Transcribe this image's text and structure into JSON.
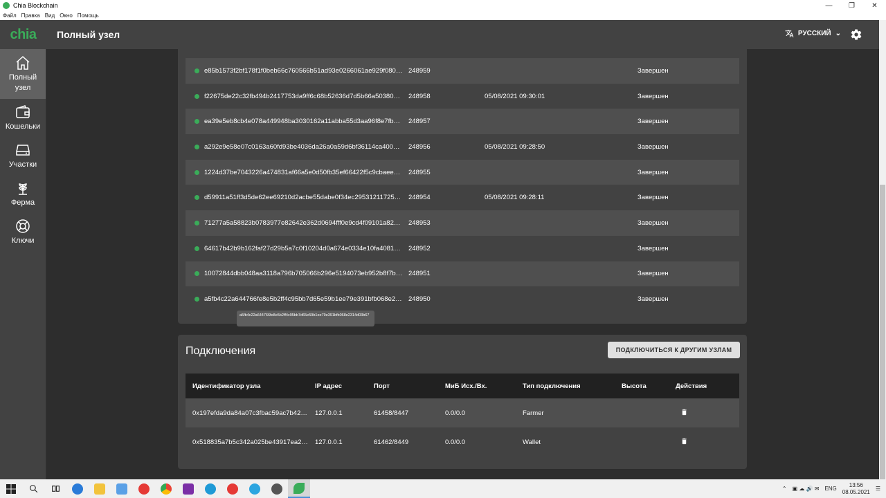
{
  "window": {
    "title": "Chia Blockchain",
    "menu": [
      "Файл",
      "Правка",
      "Вид",
      "Окно",
      "Помощь"
    ]
  },
  "header": {
    "logo": "chia",
    "title": "Полный узел",
    "language": "РУССКИЙ"
  },
  "sidebar": {
    "items": [
      {
        "label": "Полный узел",
        "icon": "home-icon"
      },
      {
        "label": "Кошельки",
        "icon": "wallet-icon"
      },
      {
        "label": "Участки",
        "icon": "storage-icon"
      },
      {
        "label": "Ферма",
        "icon": "farm-icon"
      },
      {
        "label": "Ключи",
        "icon": "lifebuoy-icon"
      }
    ]
  },
  "blocks": {
    "rows": [
      {
        "hash": "e85b1573f2bf178f1f0beb66c760566b51ad93e0266061ae929f080…",
        "height": "248959",
        "time": "",
        "state": "Завершен"
      },
      {
        "hash": "f22675de22c32fb494b2417753da9ff6c68b52636d7d5b66a503801…",
        "height": "248958",
        "time": "05/08/2021 09:30:01",
        "state": "Завершен"
      },
      {
        "hash": "ea39e5eb8cb4e078a449948ba3030162a11abba55d3aa96f8e7fbb7…",
        "height": "248957",
        "time": "",
        "state": "Завершен"
      },
      {
        "hash": "a292e9e58e07c0163a60fd93be4036da26a0a59d6bf36114ca40044…",
        "height": "248956",
        "time": "05/08/2021 09:28:50",
        "state": "Завершен"
      },
      {
        "hash": "1224d37be7043226a474831af66a5e0d50fb35ef66422f5c9cbaee7…",
        "height": "248955",
        "time": "",
        "state": "Завершен"
      },
      {
        "hash": "d59911a51ff3d5de62ee69210d2acbe55dabe0f34ec295312117251…",
        "height": "248954",
        "time": "05/08/2021 09:28:11",
        "state": "Завершен"
      },
      {
        "hash": "71277a5a58823b0783977e82642e362d0694fff0e9cd4f09101a825…",
        "height": "248953",
        "time": "",
        "state": "Завершен"
      },
      {
        "hash": "64617b42b9b162faf27d29b5a7c0f10204d0a674e0334e10fa40815…",
        "height": "248952",
        "time": "",
        "state": "Завершен"
      },
      {
        "hash": "10072844dbb048aa3118a796b705066b296e5194073eb952b8f7b1…",
        "height": "248951",
        "time": "",
        "state": "Завершен"
      },
      {
        "hash": "a5fb4c22a644766fe8e5b2ff4c95bb7d65e59b1ee79e391bfb068e23…",
        "height": "248950",
        "time": "",
        "state": "Завершен"
      }
    ],
    "tooltip": "a5fb4c22a644766fe8e5b2ff4c95bb7d65e59b1ee79e391bfb068e2314d03b67"
  },
  "connections": {
    "title": "Подключения",
    "connect_button": "ПОДКЛЮЧИТЬСЯ К ДРУГИМ УЗЛАМ",
    "headers": [
      "Идентификатор узла",
      "IP адрес",
      "Порт",
      "МиБ Исх./Вх.",
      "Тип подключения",
      "Высота",
      "Действия"
    ],
    "rows": [
      {
        "node_id": "0x197efda9da84a07c3fbac59ac7b42…",
        "ip": "127.0.0.1",
        "port": "61458/8447",
        "mib": "0.0/0.0",
        "type": "Farmer",
        "height": ""
      },
      {
        "node_id": "0x518835a7b5c342a025be43917ea2…",
        "ip": "127.0.0.1",
        "port": "61462/8449",
        "mib": "0.0/0.0",
        "type": "Wallet",
        "height": ""
      }
    ]
  },
  "taskbar": {
    "lang": "ENG",
    "time": "13:56",
    "date": "08.05.2021"
  },
  "colors": {
    "accent": "#3aac59",
    "panel": "#424242",
    "background": "#2d2d2d"
  }
}
